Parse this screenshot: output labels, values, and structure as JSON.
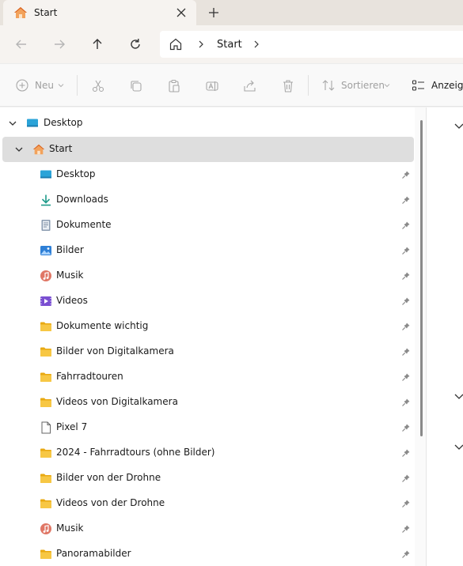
{
  "tab": {
    "title": "Start",
    "icon": "home-icon"
  },
  "address": {
    "crumb": "Start"
  },
  "commands": {
    "new_label": "Neu",
    "sort_label": "Sortieren",
    "view_label": "Anzeigen"
  },
  "tree": {
    "desktop_root": "Desktop",
    "start": "Start",
    "items": [
      {
        "label": "Desktop",
        "icon": "desktop-icon"
      },
      {
        "label": "Downloads",
        "icon": "download-icon"
      },
      {
        "label": "Dokumente",
        "icon": "document-icon"
      },
      {
        "label": "Bilder",
        "icon": "pictures-icon"
      },
      {
        "label": "Musik",
        "icon": "music-icon"
      },
      {
        "label": "Videos",
        "icon": "videos-icon"
      },
      {
        "label": "Dokumente wichtig",
        "icon": "folder-icon"
      },
      {
        "label": "Bilder von Digitalkamera",
        "icon": "folder-icon"
      },
      {
        "label": "Fahrradtouren",
        "icon": "folder-icon"
      },
      {
        "label": "Videos von Digitalkamera",
        "icon": "folder-icon"
      },
      {
        "label": "Pixel 7",
        "icon": "file-icon"
      },
      {
        "label": "2024 - Fahrradtours (ohne Bilder)",
        "icon": "folder-icon"
      },
      {
        "label": "Bilder von der Drohne",
        "icon": "folder-icon"
      },
      {
        "label": "Videos von der Drohne",
        "icon": "folder-icon"
      },
      {
        "label": "Musik",
        "icon": "music-icon"
      },
      {
        "label": "Panoramabilder",
        "icon": "folder-icon"
      }
    ]
  },
  "colors": {
    "folder": "#f5c23f",
    "accent_home": "#e8813a",
    "selected_row": "#dedede"
  }
}
